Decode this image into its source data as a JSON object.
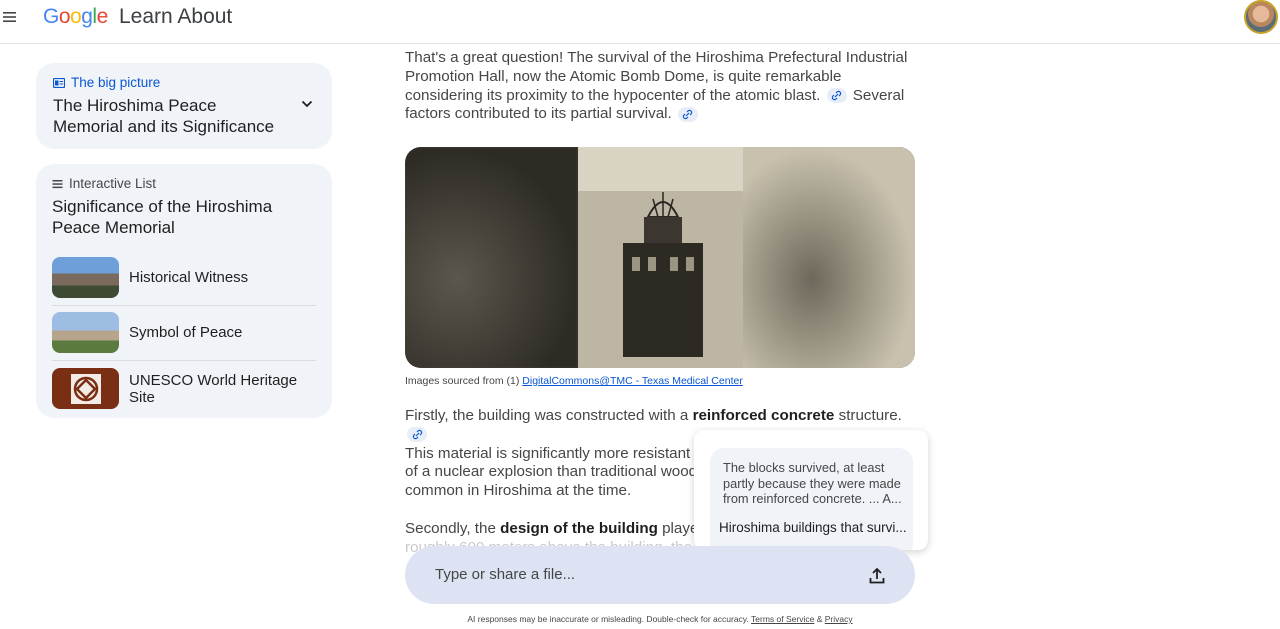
{
  "header": {
    "logo_letters": [
      {
        "char": "G",
        "color": "#4285f4"
      },
      {
        "char": "o",
        "color": "#ea4335"
      },
      {
        "char": "o",
        "color": "#fbbc05"
      },
      {
        "char": "g",
        "color": "#4285f4"
      },
      {
        "char": "l",
        "color": "#34a853"
      },
      {
        "char": "e",
        "color": "#ea4335"
      }
    ],
    "app_title": "Learn About",
    "menu_icon": "hamburger-menu-icon",
    "avatar_icon": "user-avatar"
  },
  "big_picture": {
    "eyebrow": "The big picture",
    "title": "The Hiroshima Peace Memorial and its Significance",
    "accent_color": "#0b57d0"
  },
  "interactive_list": {
    "eyebrow": "Interactive List",
    "title": "Significance of the Hiroshima Peace Memorial",
    "items": [
      {
        "label": "Historical Witness"
      },
      {
        "label": "Symbol of Peace"
      },
      {
        "label": "UNESCO World Heritage Site"
      }
    ]
  },
  "article": {
    "intro_part1": "That's a great question! The survival of the Hiroshima Prefectural Industrial Promotion Hall, now the Atomic Bomb Dome, is quite remarkable considering its proximity to the hypocenter of the atomic blast.",
    "intro_part2": "Several factors contributed to its partial survival.",
    "source_prefix": "Images sourced from (1)",
    "source_link": "DigitalCommons@TMC - Texas Medical Center",
    "firstly_pre": "Firstly, the building was constructed with a ",
    "firstly_bold": "reinforced concrete",
    "firstly_post": " structure.",
    "firstly_line2": "This material is significantly more resistant to th",
    "firstly_line3": "of a nuclear explosion than traditional wooden",
    "firstly_line4": "common in Hiroshima at the time.",
    "secondly_pre": "Secondly, the ",
    "secondly_bold": "design of the building",
    "secondly_post": " played a",
    "secondly_line2": "roughly 600 meters above the building, the do"
  },
  "popup": {
    "snippet": "The blocks survived, at least partly because they were made from reinforced concrete. ... A...",
    "link_title": "Hiroshima buildings that survi..."
  },
  "composer": {
    "placeholder": "Type or share a file..."
  },
  "footer": {
    "disclaimer": "AI responses may be inaccurate or misleading. Double-check for accuracy.",
    "terms": "Terms of Service",
    "amp": "&",
    "privacy": "Privacy"
  }
}
